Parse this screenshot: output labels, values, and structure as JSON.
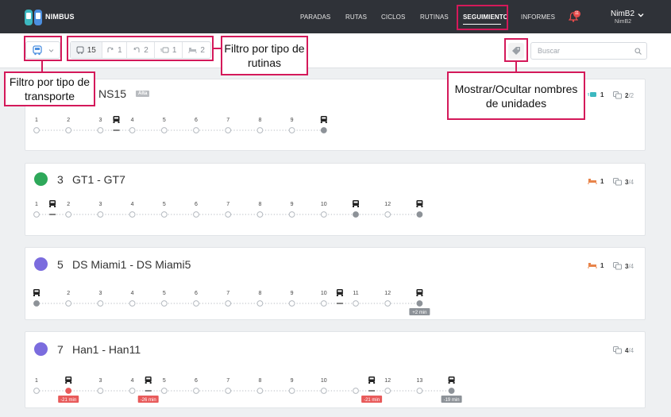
{
  "app": {
    "brand": "NIMBUS"
  },
  "nav": {
    "items": [
      "PARADAS",
      "RUTAS",
      "CICLOS",
      "RUTINAS",
      "SEGUIMIENTO",
      "INFORMES"
    ],
    "active": "SEGUIMIENTO",
    "notifications_count": "11",
    "user_name": "NimB2",
    "user_sub": "NimB2"
  },
  "filters": {
    "routine_counts": [
      "15",
      "1",
      "2",
      "1",
      "2"
    ],
    "search_placeholder": "Buscar"
  },
  "callouts": {
    "transport": "Filtro por tipo de transporte",
    "routines": "Filtro por tipo de rutinas",
    "names": "Mostrar/Ocultar nombres de unidades"
  },
  "colors": {
    "topbar": "#2f3238",
    "highlight": "#d4195a",
    "route_green": "#2ea85a",
    "route_purple": "#7b6cde",
    "delay_badge": "#e85a5a",
    "ahead_badge": "#8d9298"
  },
  "routes": [
    {
      "number": "",
      "name": "NS15",
      "badge": "Alta",
      "icon_color": "",
      "stat1_value": "1",
      "stat1_color": "#3cb8c0",
      "stat2_value": "2",
      "stat2_total": "/2",
      "stops": [
        "1",
        "2",
        "3",
        "4",
        "5",
        "6",
        "7",
        "8",
        "9",
        ""
      ],
      "buses_between": [
        2
      ],
      "buses_at_stop": [
        9
      ],
      "filled_stops": [
        9
      ],
      "labels": []
    },
    {
      "number": "3",
      "name": "GT1 - GT7",
      "badge": "",
      "icon_color": "#2ea85a",
      "stat1_value": "1",
      "stat1_color": "#e8844a",
      "stat2_value": "3",
      "stat2_total": "/4",
      "stops": [
        "1",
        "2",
        "3",
        "4",
        "5",
        "6",
        "7",
        "8",
        "9",
        "10",
        "",
        "12",
        ""
      ],
      "buses_between": [
        0
      ],
      "buses_at_stop": [
        10,
        12
      ],
      "filled_stops": [
        10,
        12
      ],
      "labels": []
    },
    {
      "number": "5",
      "name": "DS Miami1 - DS Miami5",
      "badge": "",
      "icon_color": "#7b6cde",
      "stat1_value": "1",
      "stat1_color": "#e8844a",
      "stat2_value": "3",
      "stat2_total": "/4",
      "stops": [
        "",
        "2",
        "3",
        "4",
        "5",
        "6",
        "7",
        "8",
        "9",
        "10",
        "11",
        "12",
        ""
      ],
      "buses_between": [
        9
      ],
      "buses_at_stop": [
        0,
        12
      ],
      "filled_stops": [
        0,
        12
      ],
      "labels": [
        {
          "stop": 12,
          "text": "+2 min",
          "kind": "ahead"
        }
      ]
    },
    {
      "number": "7",
      "name": "Han1 - Han11",
      "badge": "",
      "icon_color": "#7b6cde",
      "stat1_value": "",
      "stat1_color": "",
      "stat2_value": "4",
      "stat2_total": "/4",
      "stops": [
        "1",
        "",
        "3",
        "4",
        "5",
        "6",
        "7",
        "8",
        "9",
        "10",
        "",
        "12",
        "13",
        ""
      ],
      "buses_between": [
        3,
        10
      ],
      "buses_at_stop": [
        1,
        13
      ],
      "filled_stops": [
        1,
        13
      ],
      "labels": [
        {
          "stop": 1,
          "text": "-21 min",
          "kind": "late"
        },
        {
          "stop": 3.5,
          "text": "-26 min",
          "kind": "late"
        },
        {
          "stop": 10.5,
          "text": "-21 min",
          "kind": "late"
        },
        {
          "stop": 13,
          "text": "-19 min",
          "kind": "ahead"
        }
      ]
    }
  ]
}
